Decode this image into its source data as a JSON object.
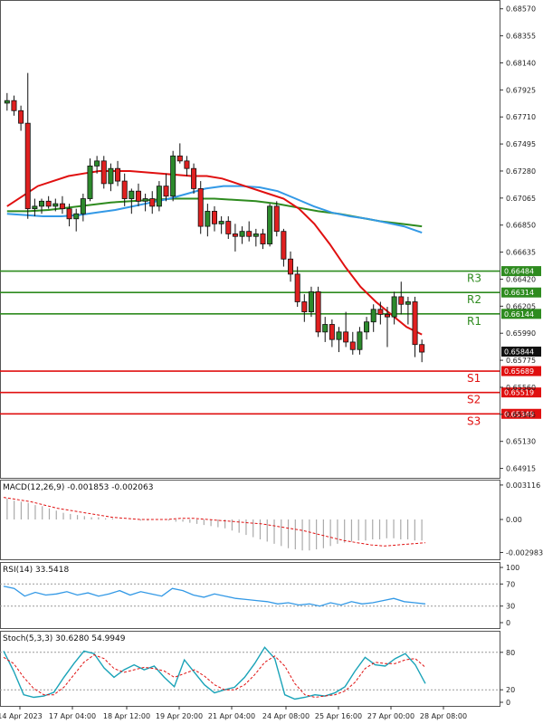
{
  "chart_data": {
    "type": "candlestick",
    "price_axis": {
      "ticks": [
        "0.68570",
        "0.68355",
        "0.68140",
        "0.67925",
        "0.67710",
        "0.67495",
        "0.67280",
        "0.67065",
        "0.66850",
        "0.66635",
        "0.66420",
        "0.66205",
        "0.65990",
        "0.65775",
        "0.65560",
        "0.65345",
        "0.65130",
        "0.64915"
      ],
      "range": [
        0.6484,
        0.6864
      ]
    },
    "time_axis": {
      "labels": [
        "14 Apr 2023",
        "17 Apr 04:00",
        "18 Apr 12:00",
        "19 Apr 20:00",
        "21 Apr 04:00",
        "24 Apr 08:00",
        "25 Apr 16:00",
        "27 Apr 00:00",
        "28 Apr 08:00"
      ]
    },
    "last_price": {
      "label": "0.65844",
      "value": 0.65844
    },
    "levels": [
      {
        "name": "R3",
        "value": 0.66484,
        "label": "0.66484",
        "color": "#2e8b1f"
      },
      {
        "name": "R2",
        "value": 0.66314,
        "label": "0.66314",
        "color": "#2e8b1f"
      },
      {
        "name": "R1",
        "value": 0.66144,
        "label": "0.66144",
        "color": "#2e8b1f"
      },
      {
        "name": "S1",
        "value": 0.65689,
        "label": "0.65689",
        "color": "#e01010"
      },
      {
        "name": "S2",
        "value": 0.65519,
        "label": "0.65519",
        "color": "#e01010"
      },
      {
        "name": "S3",
        "value": 0.65349,
        "label": "0.65349",
        "color": "#e01010"
      }
    ],
    "candles": [
      [
        0.6782,
        0.679,
        0.6776,
        0.6784
      ],
      [
        0.6784,
        0.6788,
        0.6772,
        0.6776
      ],
      [
        0.6776,
        0.678,
        0.676,
        0.6766
      ],
      [
        0.6766,
        0.6806,
        0.669,
        0.6698
      ],
      [
        0.6698,
        0.6706,
        0.6692,
        0.67
      ],
      [
        0.67,
        0.6706,
        0.6694,
        0.6704
      ],
      [
        0.6704,
        0.6708,
        0.6698,
        0.67
      ],
      [
        0.67,
        0.6706,
        0.6696,
        0.6702
      ],
      [
        0.6702,
        0.6708,
        0.6694,
        0.6698
      ],
      [
        0.6698,
        0.6702,
        0.6684,
        0.669
      ],
      [
        0.669,
        0.6698,
        0.668,
        0.6694
      ],
      [
        0.6694,
        0.671,
        0.6688,
        0.6706
      ],
      [
        0.6706,
        0.6738,
        0.6704,
        0.6732
      ],
      [
        0.6732,
        0.674,
        0.6726,
        0.6736
      ],
      [
        0.6736,
        0.674,
        0.6714,
        0.6718
      ],
      [
        0.6718,
        0.6734,
        0.6712,
        0.673
      ],
      [
        0.673,
        0.6736,
        0.6716,
        0.672
      ],
      [
        0.672,
        0.6726,
        0.67,
        0.6706
      ],
      [
        0.6706,
        0.6714,
        0.6694,
        0.6712
      ],
      [
        0.6712,
        0.6718,
        0.67,
        0.6704
      ],
      [
        0.6704,
        0.671,
        0.6696,
        0.6706
      ],
      [
        0.6706,
        0.6712,
        0.6694,
        0.67
      ],
      [
        0.67,
        0.672,
        0.6696,
        0.6716
      ],
      [
        0.6716,
        0.6726,
        0.6704,
        0.6708
      ],
      [
        0.6708,
        0.6744,
        0.6704,
        0.674
      ],
      [
        0.674,
        0.675,
        0.6734,
        0.6736
      ],
      [
        0.6736,
        0.674,
        0.6724,
        0.673
      ],
      [
        0.673,
        0.6734,
        0.671,
        0.6714
      ],
      [
        0.6714,
        0.672,
        0.6678,
        0.6684
      ],
      [
        0.6684,
        0.6702,
        0.6676,
        0.6696
      ],
      [
        0.6696,
        0.67,
        0.668,
        0.6686
      ],
      [
        0.6686,
        0.6692,
        0.6678,
        0.6688
      ],
      [
        0.6688,
        0.6692,
        0.6674,
        0.6678
      ],
      [
        0.6678,
        0.6686,
        0.6664,
        0.6676
      ],
      [
        0.6676,
        0.6684,
        0.667,
        0.668
      ],
      [
        0.668,
        0.6688,
        0.6672,
        0.6676
      ],
      [
        0.6676,
        0.6682,
        0.6668,
        0.6678
      ],
      [
        0.6678,
        0.6682,
        0.6666,
        0.667
      ],
      [
        0.667,
        0.6702,
        0.6668,
        0.67
      ],
      [
        0.67,
        0.6704,
        0.6676,
        0.668
      ],
      [
        0.668,
        0.6682,
        0.6652,
        0.6658
      ],
      [
        0.6658,
        0.6664,
        0.664,
        0.6646
      ],
      [
        0.6646,
        0.6652,
        0.662,
        0.6624
      ],
      [
        0.6624,
        0.663,
        0.6608,
        0.6616
      ],
      [
        0.6616,
        0.6636,
        0.6612,
        0.6632
      ],
      [
        0.6632,
        0.6636,
        0.6596,
        0.66
      ],
      [
        0.66,
        0.6612,
        0.6592,
        0.6606
      ],
      [
        0.6606,
        0.661,
        0.6588,
        0.6594
      ],
      [
        0.6594,
        0.6604,
        0.6584,
        0.66
      ],
      [
        0.66,
        0.6616,
        0.6588,
        0.6592
      ],
      [
        0.6592,
        0.66,
        0.6582,
        0.6586
      ],
      [
        0.6586,
        0.6604,
        0.6582,
        0.66
      ],
      [
        0.66,
        0.6612,
        0.6594,
        0.6608
      ],
      [
        0.6608,
        0.6622,
        0.66,
        0.6618
      ],
      [
        0.6618,
        0.6624,
        0.6606,
        0.6614
      ],
      [
        0.6614,
        0.662,
        0.6588,
        0.6612
      ],
      [
        0.6612,
        0.6632,
        0.6606,
        0.6628
      ],
      [
        0.6628,
        0.664,
        0.6614,
        0.6622
      ],
      [
        0.6622,
        0.6628,
        0.6606,
        0.6624
      ],
      [
        0.6624,
        0.6628,
        0.658,
        0.659
      ],
      [
        0.659,
        0.6594,
        0.6576,
        0.6584
      ]
    ],
    "ma_red": [
      0.67,
      0.6708,
      0.6716,
      0.672,
      0.6724,
      0.6726,
      0.6728,
      0.6728,
      0.6728,
      0.6727,
      0.6726,
      0.6725,
      0.6724,
      0.6724,
      0.6722,
      0.6718,
      0.6714,
      0.671,
      0.6706,
      0.6698,
      0.6686,
      0.667,
      0.6652,
      0.6636,
      0.6624,
      0.6614,
      0.6604,
      0.6598
    ],
    "ma_blue": [
      0.6694,
      0.6693,
      0.6692,
      0.6692,
      0.6693,
      0.6695,
      0.6697,
      0.67,
      0.6703,
      0.6706,
      0.671,
      0.6714,
      0.6716,
      0.6716,
      0.6715,
      0.6712,
      0.6706,
      0.67,
      0.6695,
      0.6692,
      0.669,
      0.6687,
      0.6684,
      0.6679
    ],
    "ma_green": [
      0.6696,
      0.6696,
      0.6697,
      0.6699,
      0.6701,
      0.6703,
      0.6704,
      0.6705,
      0.6706,
      0.6706,
      0.6706,
      0.6705,
      0.6704,
      0.6702,
      0.6699,
      0.6696,
      0.6694,
      0.6691,
      0.6688,
      0.6686,
      0.6684
    ],
    "macd": {
      "title": "MACD(12,26,9) -0.001853 -0.002063",
      "ticks": [
        "0.003116",
        "0.00",
        "-0.002983"
      ],
      "range": [
        -0.0036,
        0.0036
      ],
      "hist": [
        0.0019,
        0.0017,
        0.0016,
        0.0015,
        0.0013,
        0.0012,
        0.001,
        0.0008,
        0.0006,
        0.0005,
        0.0004,
        0.0003,
        0.0002,
        0.0002,
        0.0001,
        0.0001,
        0.0,
        0.0,
        0.0,
        -0.0001,
        -0.0001,
        0.0,
        0.0,
        -0.0001,
        -0.0002,
        -0.0002,
        -0.0003,
        -0.0004,
        -0.0005,
        -0.0006,
        -0.0007,
        -0.0008,
        -0.001,
        -0.0012,
        -0.0014,
        -0.0016,
        -0.0018,
        -0.002,
        -0.0022,
        -0.0024,
        -0.0026,
        -0.0027,
        -0.0028,
        -0.0028,
        -0.0027,
        -0.0026,
        -0.0024,
        -0.0022,
        -0.0021,
        -0.002,
        -0.0019,
        -0.0019,
        -0.0018,
        -0.0018,
        -0.0017,
        -0.0017,
        -0.0018,
        -0.0018,
        -0.0019,
        -0.0019
      ],
      "signal": [
        0.002,
        0.0018,
        0.0016,
        0.0013,
        0.001,
        0.0008,
        0.0006,
        0.0004,
        0.0002,
        0.0001,
        0.0,
        0.0,
        0.0,
        0.0001,
        0.0001,
        0.0,
        -0.0001,
        -0.0002,
        -0.0003,
        -0.0004,
        -0.0006,
        -0.0008,
        -0.001,
        -0.0013,
        -0.0016,
        -0.0019,
        -0.0021,
        -0.0023,
        -0.0024,
        -0.0023,
        -0.0022,
        -0.0021
      ]
    },
    "rsi": {
      "title": "RSI(14) 33.5418",
      "ticks": [
        "100",
        "70",
        "30",
        "0"
      ],
      "values": [
        66,
        62,
        48,
        55,
        50,
        52,
        56,
        50,
        54,
        48,
        52,
        58,
        50,
        56,
        52,
        48,
        62,
        58,
        50,
        46,
        52,
        48,
        44,
        42,
        40,
        38,
        34,
        36,
        32,
        34,
        30,
        36,
        32,
        38,
        34,
        36,
        40,
        44,
        38,
        36,
        34
      ]
    },
    "stoch": {
      "title": "Stoch(5,3,3) 30.6280 54.9949",
      "ticks": [
        "80",
        "20",
        "0"
      ],
      "k": [
        82,
        50,
        12,
        8,
        10,
        16,
        40,
        62,
        82,
        78,
        55,
        40,
        52,
        60,
        52,
        58,
        40,
        25,
        68,
        48,
        28,
        15,
        20,
        24,
        40,
        62,
        88,
        70,
        12,
        5,
        8,
        12,
        10,
        15,
        25,
        50,
        72,
        60,
        58,
        70,
        78,
        60,
        30
      ],
      "d": [
        72,
        62,
        40,
        22,
        12,
        12,
        24,
        44,
        64,
        76,
        70,
        54,
        48,
        52,
        56,
        54,
        50,
        40,
        46,
        52,
        42,
        28,
        20,
        20,
        28,
        44,
        64,
        74,
        58,
        30,
        12,
        8,
        10,
        12,
        18,
        32,
        54,
        64,
        62,
        62,
        68,
        70,
        56
      ]
    }
  }
}
